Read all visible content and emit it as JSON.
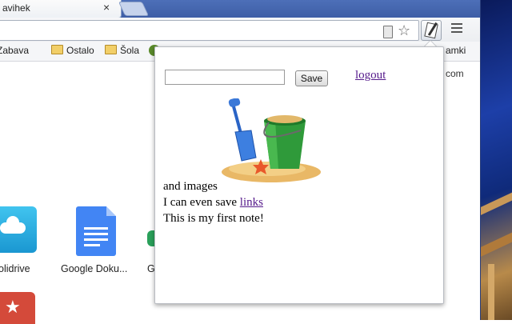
{
  "browser": {
    "tab_title": "avihek",
    "tab_close_icon": "×",
    "bookmarks": [
      "Zabava",
      "Ostalo",
      "Šola"
    ],
    "bookmark_right": "amki",
    "content_right_text": "com"
  },
  "apps": [
    {
      "label": "olidrive"
    },
    {
      "label": "Google Doku..."
    },
    {
      "label": "G"
    }
  ],
  "popup": {
    "input_value": "",
    "save_label": "Save",
    "logout_label": "logout",
    "notes": {
      "line1": "and images",
      "line2_prefix": "I can even save ",
      "line2_link": "links",
      "line3": "This is my first note!"
    },
    "image_icon": "beach-bucket-icon"
  },
  "colors": {
    "link_visited": "#551a8b",
    "titlebar": "#4d6fb8",
    "doc_blue": "#4285f4"
  }
}
